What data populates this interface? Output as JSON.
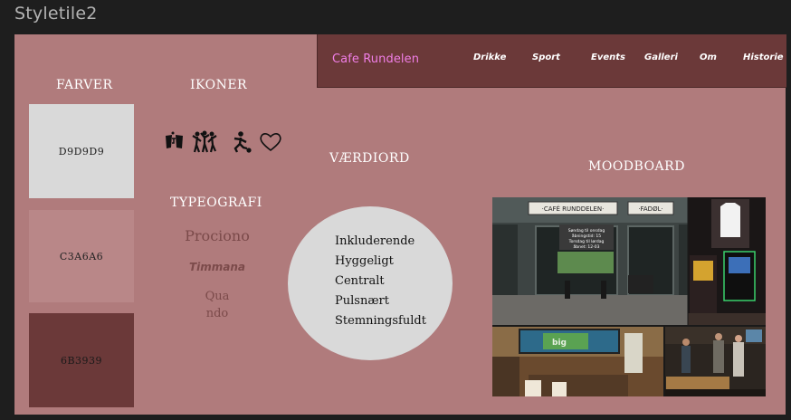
{
  "app": {
    "title": "Styletile2"
  },
  "nav": {
    "brand": "Cafe Rundelen",
    "items": [
      "Drikke",
      "Sport",
      "Events",
      "Galleri",
      "Om",
      "Historie"
    ]
  },
  "sections": {
    "colors": "FARVER",
    "icons": "IKONER",
    "typography": "TYPEOGRAFI",
    "values": "VÆRDIORD",
    "moodboard": "MOODBOARD"
  },
  "swatches": [
    {
      "hex": "D9D9D9",
      "color": "#d9d9d9",
      "text_color": "#222222"
    },
    {
      "hex": "C3A6A6",
      "color": "#b98788",
      "text_color": "#222222"
    },
    {
      "hex": "6B3939",
      "color": "#6b3939",
      "text_color": "#1a1a1a"
    }
  ],
  "icons": [
    "beer-toast-icon",
    "dancing-people-icon",
    "soccer-player-icon",
    "heart-icon"
  ],
  "fonts": {
    "prociono": "Prociono",
    "timmana": "Timmana",
    "quando_1": "Qua",
    "quando_2": "ndo"
  },
  "values": [
    "Inkluderende",
    "Hyggeligt",
    "Centralt",
    "Pulsnært",
    "Stemningsfuldt"
  ],
  "moodboard": {
    "sign_main": "·CAFÉ RUNDDELEN·",
    "sign_side": "·FADØL·",
    "window_lines": [
      "Søndag til onsdag",
      "åbningstid: 15",
      "Torsdag til lørdag",
      "åbnet: 12-03"
    ],
    "banner_text": "big"
  },
  "colors": {
    "background": "#1e1e1e",
    "board": "#b07b7c",
    "nav": "#6b3939",
    "brand": "#f07ee6",
    "circle": "#d9d9d9",
    "font_sample": "#7b4a4a"
  }
}
